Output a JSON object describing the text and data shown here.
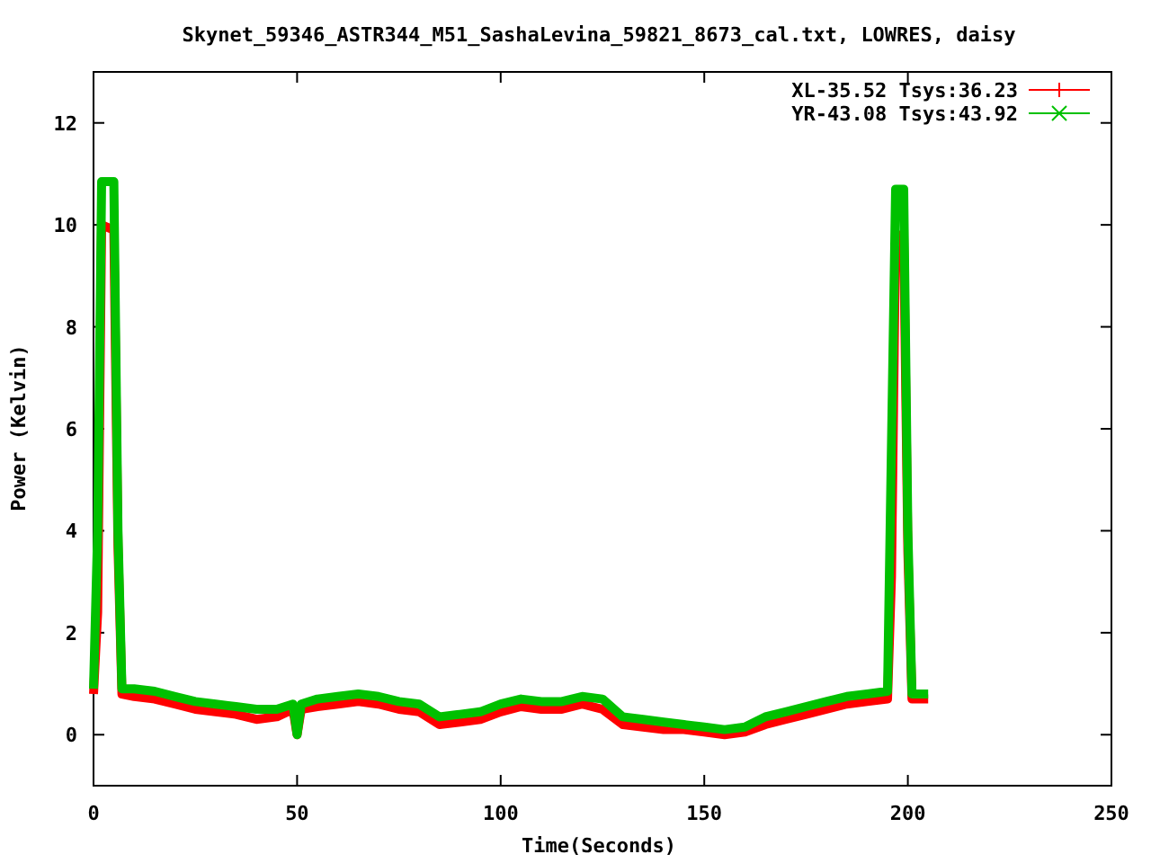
{
  "chart_data": {
    "type": "line",
    "title": "Skynet_59346_ASTR344_M51_SashaLevina_59821_8673_cal.txt, LOWRES, daisy",
    "xlabel": "Time(Seconds)",
    "ylabel": "Power (Kelvin)",
    "xlim": [
      0,
      250
    ],
    "ylim": [
      -1,
      13
    ],
    "xticks": [
      0,
      50,
      100,
      150,
      200,
      250
    ],
    "yticks": [
      0,
      2,
      4,
      6,
      8,
      10,
      12
    ],
    "legend": true,
    "x": [
      0,
      1,
      2,
      5,
      6,
      7,
      10,
      15,
      20,
      25,
      30,
      35,
      40,
      45,
      49,
      50,
      51,
      55,
      60,
      65,
      70,
      75,
      80,
      85,
      90,
      95,
      100,
      105,
      110,
      115,
      120,
      125,
      130,
      135,
      140,
      145,
      150,
      155,
      160,
      165,
      170,
      175,
      180,
      185,
      190,
      195,
      196,
      197,
      199,
      200,
      201,
      205
    ],
    "series": [
      {
        "name": "XL-35.52 Tsys:36.23",
        "color": "#ff0000",
        "values": [
          0.8,
          2.4,
          10,
          9.9,
          3.7,
          0.8,
          0.75,
          0.7,
          0.6,
          0.5,
          0.45,
          0.4,
          0.3,
          0.35,
          0.5,
          0,
          0.5,
          0.55,
          0.6,
          0.65,
          0.6,
          0.5,
          0.45,
          0.2,
          0.25,
          0.3,
          0.45,
          0.55,
          0.5,
          0.5,
          0.6,
          0.5,
          0.2,
          0.15,
          0.1,
          0.1,
          0.05,
          0,
          0.05,
          0.2,
          0.3,
          0.4,
          0.5,
          0.6,
          0.65,
          0.7,
          3.1,
          9.8,
          9.8,
          3.6,
          0.7,
          0.7
        ]
      },
      {
        "name": "YR-43.08 Tsys:43.92",
        "color": "#00c000",
        "values": [
          0.9,
          4,
          10.85,
          10.85,
          4,
          0.9,
          0.9,
          0.85,
          0.75,
          0.65,
          0.6,
          0.55,
          0.5,
          0.5,
          0.6,
          0,
          0.6,
          0.7,
          0.75,
          0.8,
          0.75,
          0.65,
          0.6,
          0.35,
          0.4,
          0.45,
          0.6,
          0.7,
          0.65,
          0.65,
          0.75,
          0.7,
          0.35,
          0.3,
          0.25,
          0.2,
          0.15,
          0.1,
          0.15,
          0.35,
          0.45,
          0.55,
          0.65,
          0.75,
          0.8,
          0.85,
          5.7,
          10.7,
          10.7,
          4,
          0.8,
          0.8
        ]
      }
    ]
  }
}
